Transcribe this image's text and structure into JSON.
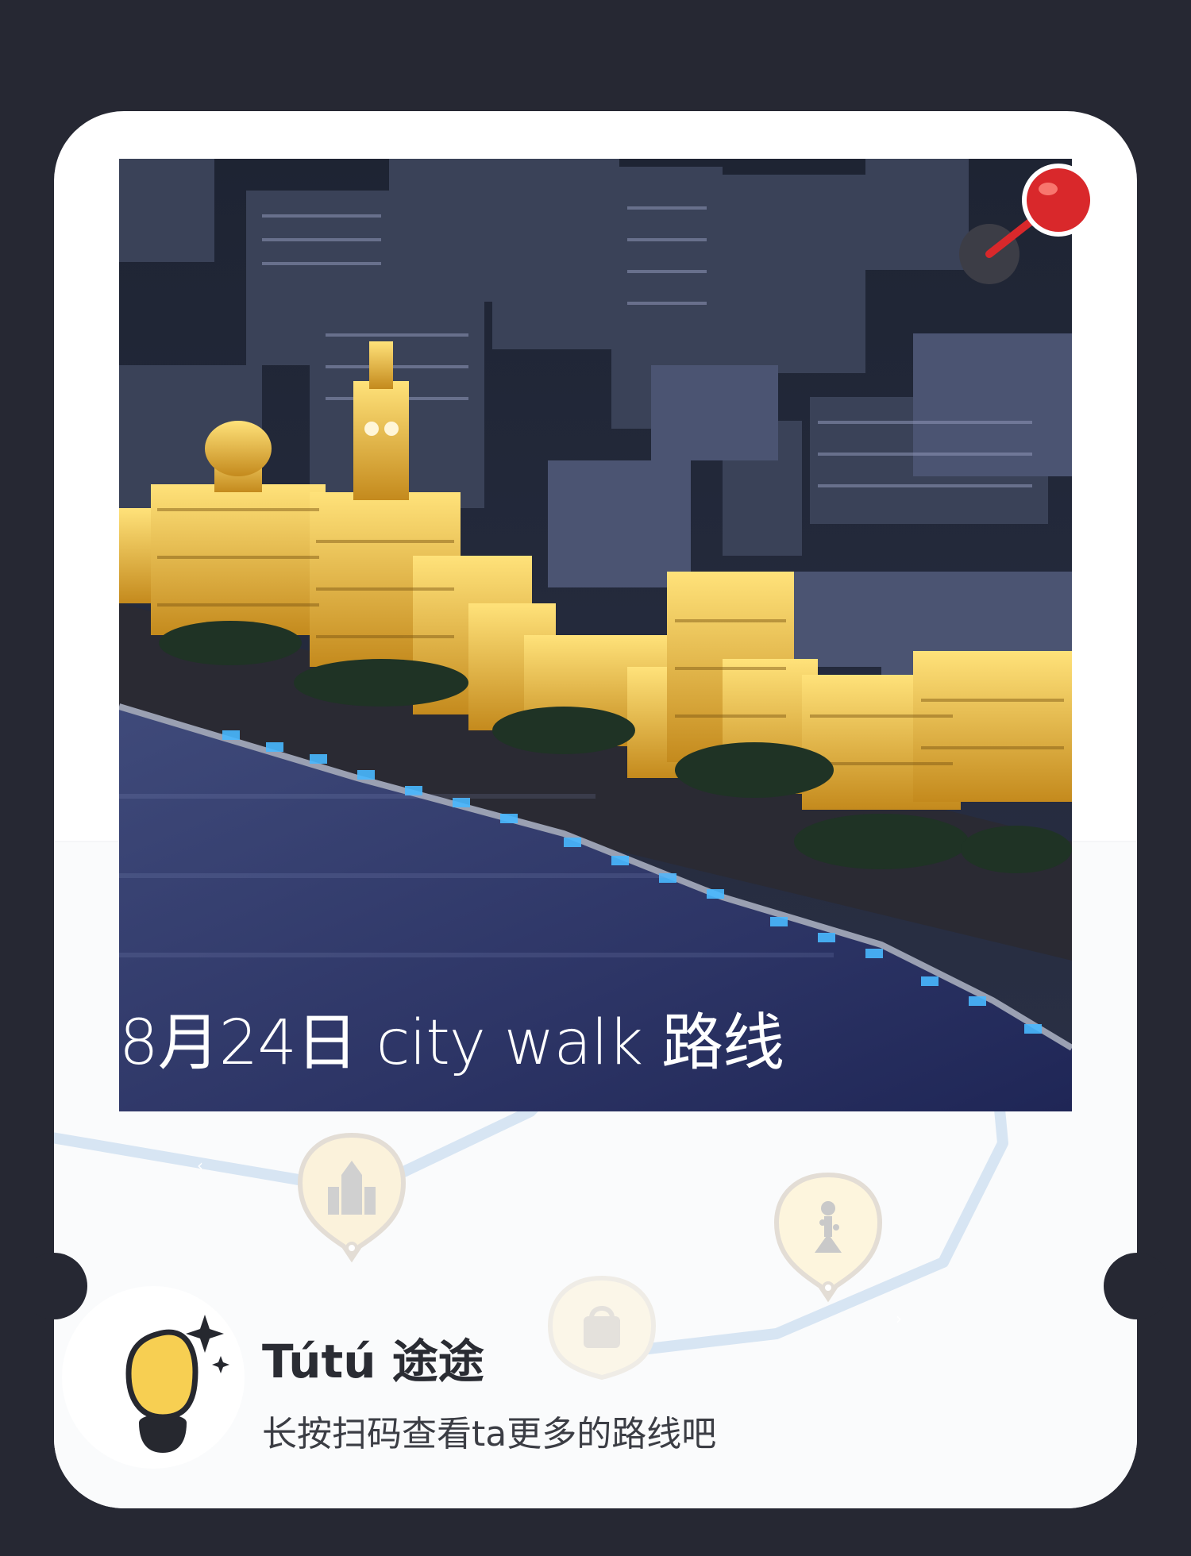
{
  "photo": {
    "caption": "8月24日 city walk 路线",
    "alt": "city-night-scene"
  },
  "brand": {
    "name": "Tútú 途途",
    "tagline": "长按扫码查看ta更多的路线吧"
  },
  "icons": {
    "pin": "map-pin-icon",
    "logo": "footprint-logo-icon",
    "markers": [
      "castle-icon",
      "shopping-bag-icon",
      "statue-icon"
    ]
  },
  "colors": {
    "background": "#262833",
    "card": "#ffffff",
    "accent_yellow": "#f7cf52",
    "route": "#c9dcf0",
    "pin_red": "#d9282b"
  }
}
